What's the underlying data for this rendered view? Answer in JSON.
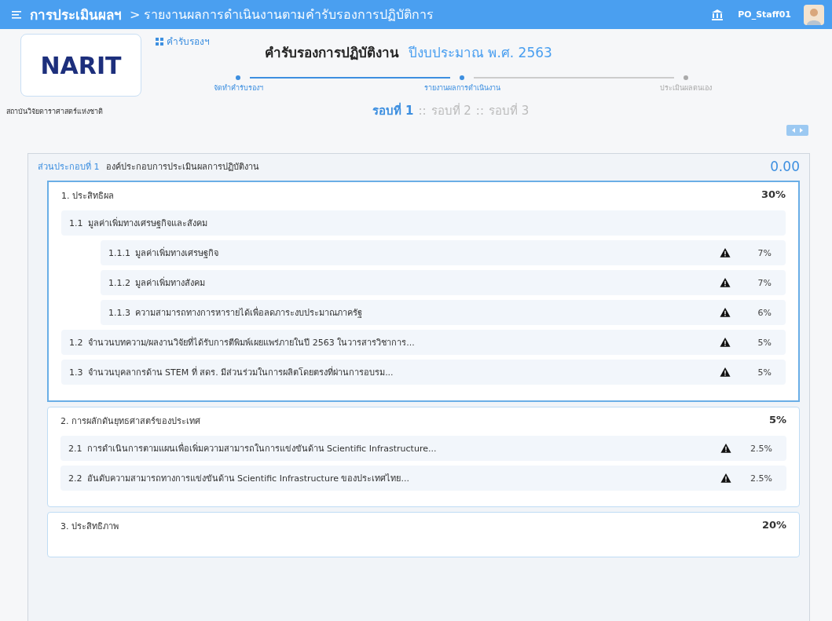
{
  "topbar": {
    "module": "การประเมินผลฯ",
    "breadcrumb": "> รายงานผลการดำเนินงานตามคำรับรองการปฏิบัติการ",
    "user": "PO_Staff01"
  },
  "org": {
    "logo_text": "NARIT",
    "name": "สถาบันวิจัยดาราศาสตร์แห่งชาติ"
  },
  "header": {
    "menu_link": "คำรับรองฯ",
    "title": "คำรับรองการปฏิบัติงาน",
    "fiscal_year": "ปีงบประมาณ พ.ศ. 2563"
  },
  "steps": [
    {
      "label": "จัดทำคำรับรองฯ",
      "done": true
    },
    {
      "label": "รายงานผลการดำเนินงาน",
      "done": true
    },
    {
      "label": "ประเมินผลตนเอง",
      "done": false
    }
  ],
  "rounds": [
    {
      "label": "รอบที่ 1",
      "selected": true
    },
    {
      "label": "รอบที่ 2",
      "selected": false
    },
    {
      "label": "รอบที่ 3",
      "selected": false
    }
  ],
  "round_separator": "::",
  "section": {
    "label": "ส่วนประกอบที่ 1",
    "title": "องค์ประกอบการประเมินผลการปฏิบัติงาน",
    "score": "0.00"
  },
  "groups": [
    {
      "title": "1. ประสิทธิผล",
      "weight": "30%",
      "selected": true,
      "items": [
        {
          "number": "1.1",
          "title": "มูลค่าเพิ่มทางเศรษฐกิจและสังคม",
          "warning": false,
          "children": [
            {
              "number": "1.1.1",
              "title": "มูลค่าเพิ่มทางเศรษฐกิจ",
              "weight": "7%",
              "warning": true
            },
            {
              "number": "1.1.2",
              "title": "มูลค่าเพิ่มทางสังคม",
              "weight": "7%",
              "warning": true
            },
            {
              "number": "1.1.3",
              "title": "ความสามารถทางการหารายได้เพื่อลดภาระงบประมาณภาครัฐ",
              "weight": "6%",
              "warning": true
            }
          ]
        },
        {
          "number": "1.2",
          "title": "จำนวนบทความ/ผลงานวิจัยที่ได้รับการตีพิมพ์เผยแพร่ภายในปี 2563 ในวารสารวิชาการ...",
          "weight": "5%",
          "warning": true
        },
        {
          "number": "1.3",
          "title": "จำนวนบุคลากรด้าน STEM ที่ สดร. มีส่วนร่วมในการผลิตโดยตรงที่ผ่านการอบรม...",
          "weight": "5%",
          "warning": true
        }
      ]
    },
    {
      "title": "2. การผลักดันยุทธศาสตร์ของประเทศ",
      "weight": "5%",
      "selected": false,
      "items": [
        {
          "number": "2.1",
          "title": "การดำเนินการตามแผนเพื่อเพิ่มความสามารถในการแข่งขันด้าน Scientific Infrastructure...",
          "weight": "2.5%",
          "warning": true
        },
        {
          "number": "2.2",
          "title": "อันดับความสามารถทางการแข่งขันด้าน Scientific Infrastructure ของประเทศไทย...",
          "weight": "2.5%",
          "warning": true
        }
      ]
    },
    {
      "title": "3. ประสิทธิภาพ",
      "weight": "20%",
      "selected": false
    }
  ]
}
